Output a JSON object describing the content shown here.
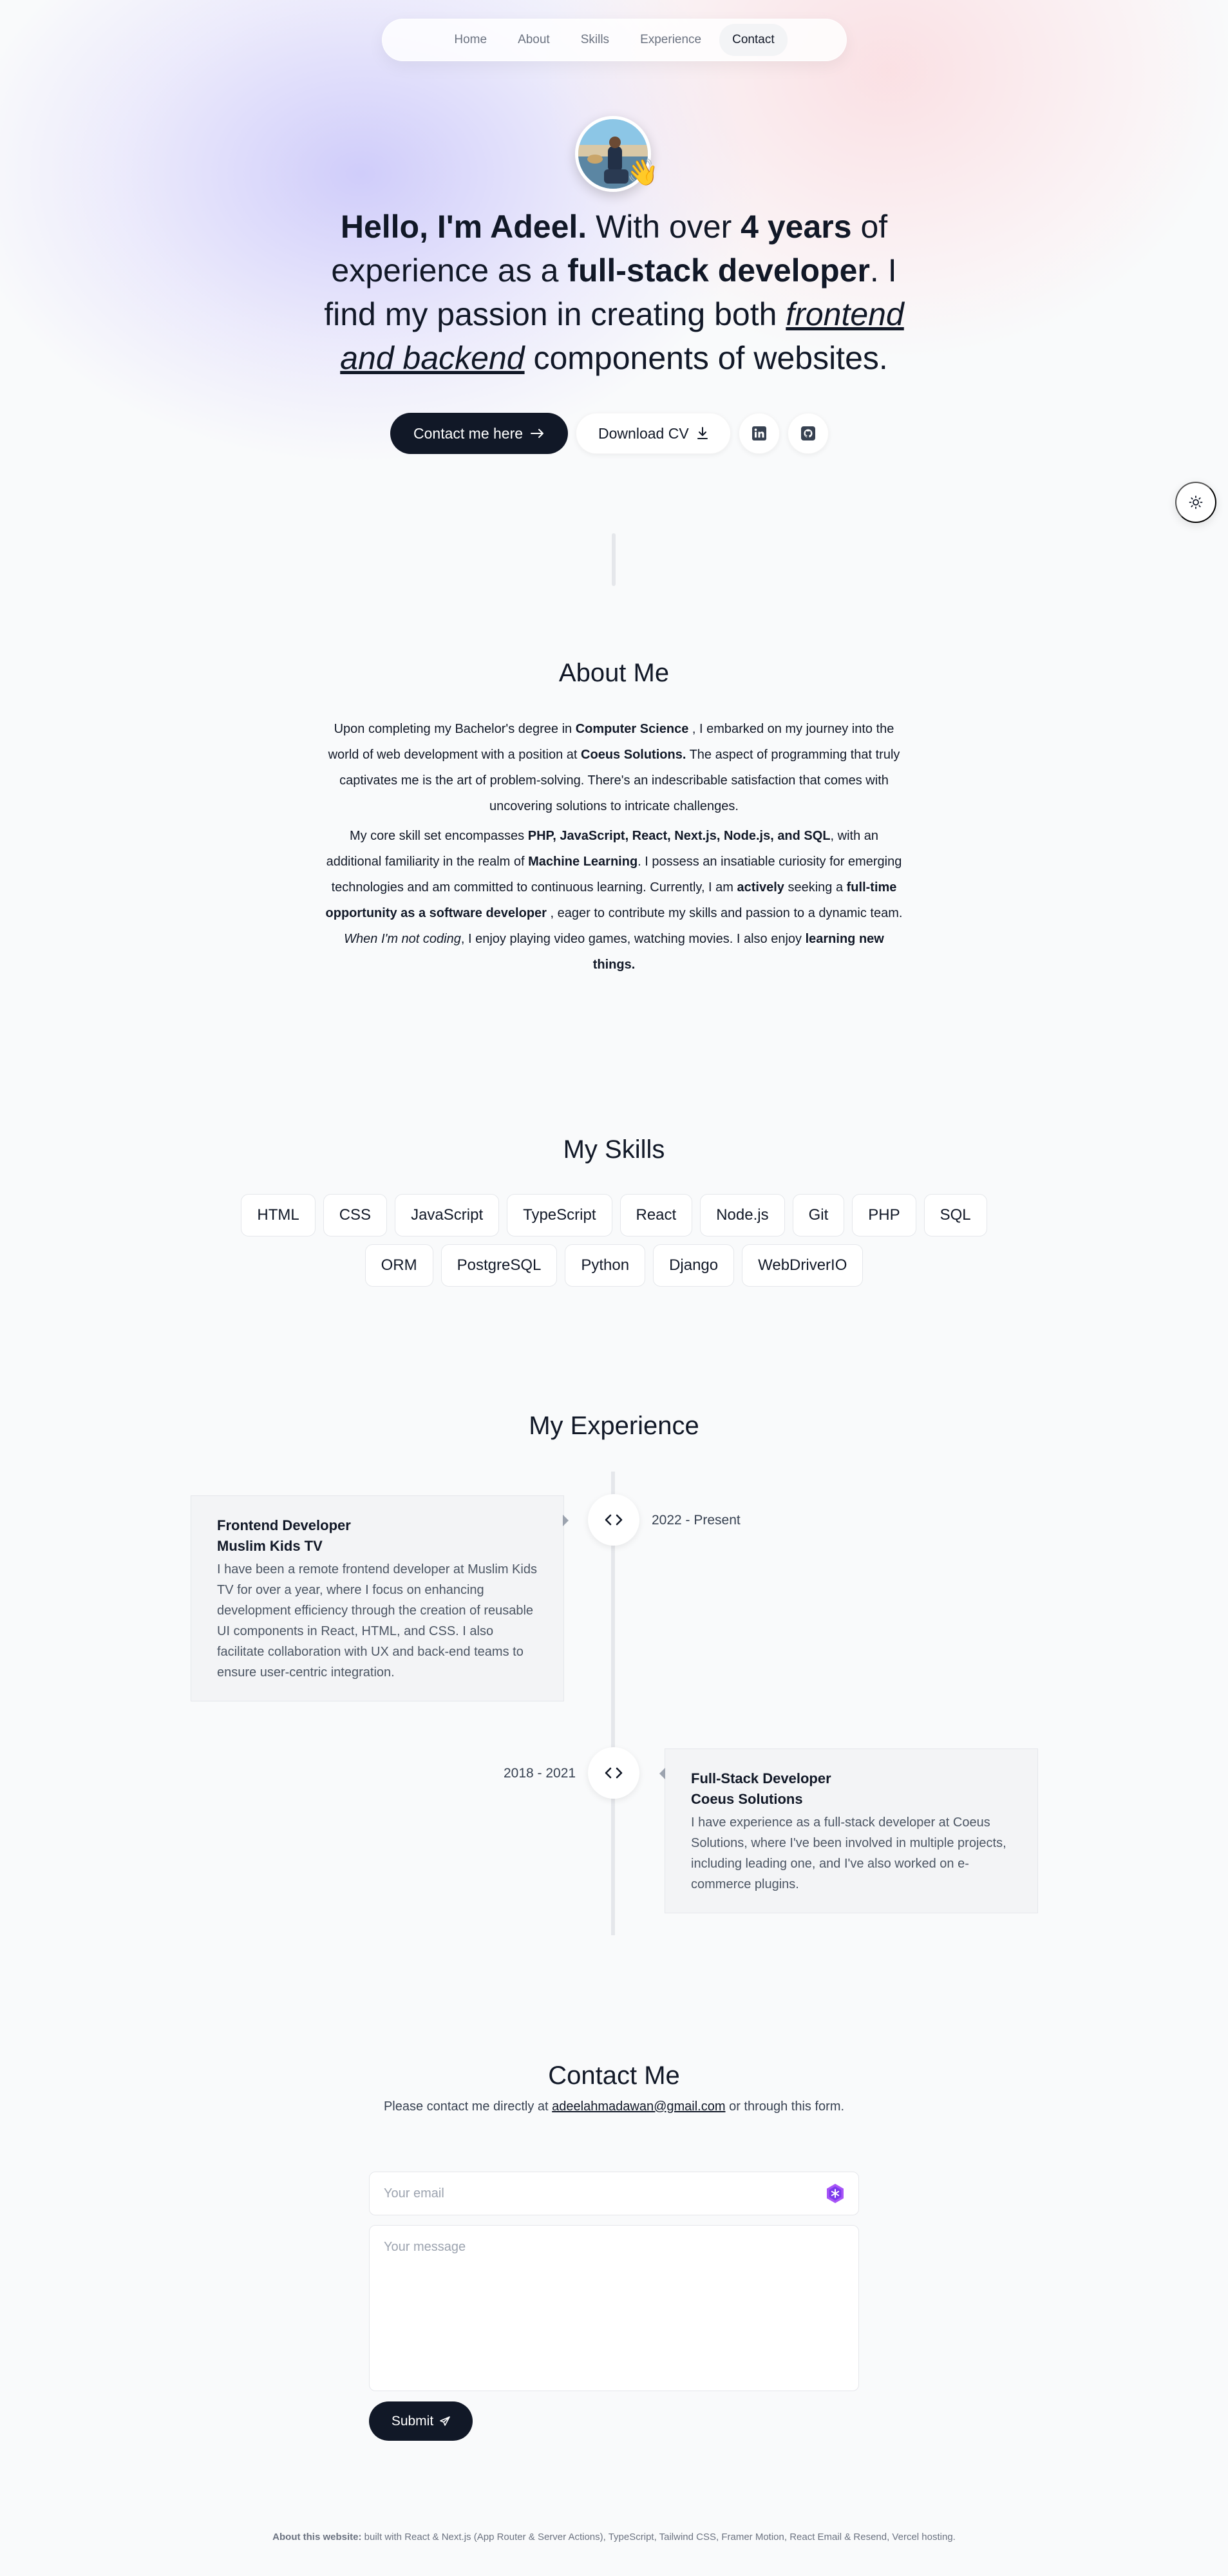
{
  "nav": {
    "items": [
      {
        "label": "Home"
      },
      {
        "label": "About"
      },
      {
        "label": "Skills"
      },
      {
        "label": "Experience"
      },
      {
        "label": "Contact",
        "active": true
      }
    ]
  },
  "hero": {
    "avatar_alt": "Profile photo",
    "wave_emoji": "👋",
    "intro": {
      "greeting": "Hello, I'm Adeel.",
      "t1": " With over ",
      "years": "4 years",
      "t2": " of experience as a ",
      "role": "full-stack developer",
      "t3": ". I find my passion in creating both ",
      "focus": "frontend and backend",
      "t4": " components of websites."
    },
    "contact_button": "Contact me here",
    "cv_button": "Download CV",
    "linkedin_icon": "linkedin-icon",
    "github_icon": "github-icon"
  },
  "theme_toggle_icon": "sun-icon",
  "about": {
    "title": "About Me",
    "p1": {
      "a": "Upon completing my Bachelor's degree in ",
      "b": "Computer Science",
      "c": " , I embarked on my journey into the world of web development with a position at ",
      "d": "Coeus Solutions.",
      "e": " The aspect of programming that truly captivates me is the art of problem-solving. There's an indescribable satisfaction that comes with uncovering solutions to intricate challenges."
    },
    "p2": {
      "a": "My core skill set encompasses ",
      "b": "PHP, JavaScript, React, Next.js, Node.js, and SQL",
      "c": ", with an additional familiarity in the realm of ",
      "d": "Machine Learning",
      "e": ". I possess an insatiable curiosity for emerging technologies and am committed to continuous learning. Currently, I am ",
      "f": "actively",
      "g": " seeking a ",
      "h": "full-time opportunity as a software developer",
      "i": " , eager to contribute my skills and passion to a dynamic team."
    },
    "p3": {
      "a": "When I'm not coding",
      "b": ", I enjoy playing video games, watching movies. I also enjoy ",
      "c": "learning new things."
    }
  },
  "skills": {
    "title": "My Skills",
    "items": [
      "HTML",
      "CSS",
      "JavaScript",
      "TypeScript",
      "React",
      "Node.js",
      "Git",
      "PHP",
      "SQL",
      "ORM",
      "PostgreSQL",
      "Python",
      "Django",
      "WebDriverIO"
    ]
  },
  "experience": {
    "title": "My Experience",
    "items": [
      {
        "title": "Frontend Developer",
        "company": "Muslim Kids TV",
        "description": "I have been a remote frontend developer at Muslim Kids TV for over a year, where I focus on enhancing development efficiency through the creation of reusable UI components in React, HTML, and CSS. I also facilitate collaboration with UX and back-end teams to ensure user-centric integration.",
        "date": "2022 - Present",
        "icon": "code-icon"
      },
      {
        "title": "Full-Stack Developer",
        "company": "Coeus Solutions",
        "description": "I have experience as a full-stack developer at Coeus Solutions, where I've been involved in multiple projects, including leading one, and I've also worked on e-commerce plugins.",
        "date": "2018 - 2021",
        "icon": "code-icon"
      }
    ]
  },
  "contact": {
    "title": "Contact Me",
    "sub_a": "Please contact me directly at ",
    "email": "adeelahmadawan@gmail.com",
    "sub_b": " or through this form.",
    "email_placeholder": "Your email",
    "message_placeholder": "Your message",
    "submit_label": "Submit",
    "submit_icon": "send-icon"
  },
  "footer": {
    "lead": "About this website:",
    "text": " built with React & Next.js (App Router & Server Actions), TypeScript, Tailwind CSS, Framer Motion, React Email & Resend, Vercel hosting."
  },
  "colors": {
    "background": "#f9fafb",
    "text": "#111827",
    "dark_button": "#111827",
    "card": "#f3f4f6"
  }
}
